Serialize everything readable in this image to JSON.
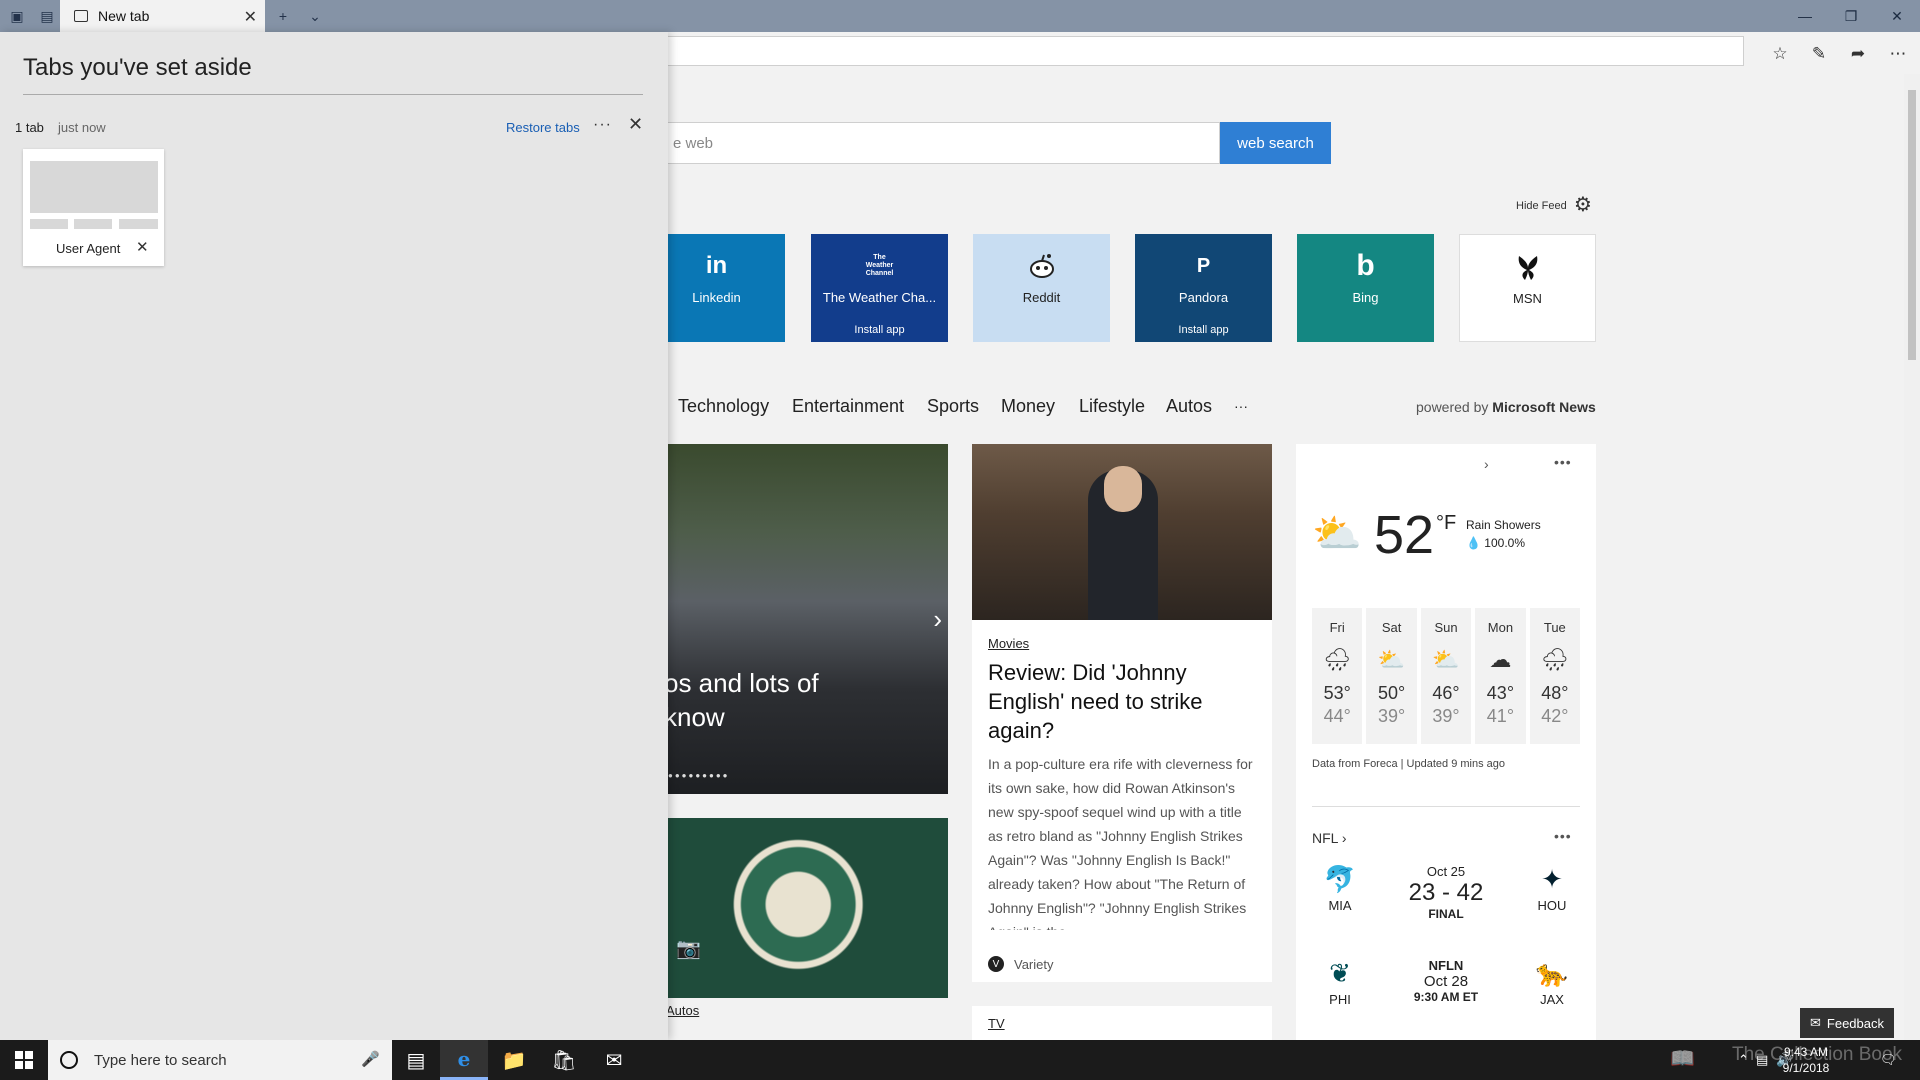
{
  "tab": {
    "title": "New tab"
  },
  "ntp": {
    "search_placeholder": "e web",
    "search_button": "web search",
    "hide_feed": "Hide Feed",
    "tiles": [
      {
        "label": "Linkedin",
        "icon": "in",
        "install": "",
        "color": "#0a77b5"
      },
      {
        "label": "The Weather Cha...",
        "icon": "The Weather Channel",
        "install": "Install app",
        "color": "#123d8c"
      },
      {
        "label": "Reddit",
        "icon": "reddit-alien",
        "install": "",
        "color": "#c8ddf2"
      },
      {
        "label": "Pandora",
        "icon": "P",
        "install": "Install app",
        "color": "#114775"
      },
      {
        "label": "Bing",
        "icon": "b",
        "install": "",
        "color": "#148782"
      },
      {
        "label": "MSN",
        "icon": "butterfly",
        "install": "",
        "color": "#ffffff"
      }
    ],
    "nav": [
      "Technology",
      "Entertainment",
      "Sports",
      "Money",
      "Lifestyle",
      "Autos",
      "···"
    ],
    "powered_by_prefix": "powered by",
    "powered_by_brand": "Microsoft News",
    "hero": {
      "headline_line1": "os and lots of",
      "headline_line2": "know",
      "dots": "●●●●●●●●●"
    },
    "autos_tag": "Autos",
    "movie": {
      "tag": "Movies",
      "title": "Review: Did 'Johnny English' need to strike again?",
      "body": "In a pop-culture era rife with cleverness for its own sake, how did Rowan Atkinson's new spy-spoof sequel wind up with a title as retro bland as \"Johnny English Strikes Again\"? Was \"Johnny English Is Back!\" already taken? How about \"The Return of Johnny English\"? \"Johnny English Strikes Again\" is the",
      "source": "Variety"
    },
    "tv_tag": "TV",
    "weather": {
      "temp": "52",
      "unit": "°F",
      "condition": "Rain Showers",
      "precip": "100.0%",
      "days": [
        {
          "name": "Fri",
          "hi": "53°",
          "lo": "44°",
          "icon": "rain-icon"
        },
        {
          "name": "Sat",
          "hi": "50°",
          "lo": "39°",
          "icon": "partly-sunny-icon"
        },
        {
          "name": "Sun",
          "hi": "46°",
          "lo": "39°",
          "icon": "partly-sunny-icon"
        },
        {
          "name": "Mon",
          "hi": "43°",
          "lo": "41°",
          "icon": "cloud-icon"
        },
        {
          "name": "Tue",
          "hi": "48°",
          "lo": "42°",
          "icon": "rain-icon"
        }
      ],
      "data_source": "Data from Foreca | Updated 9 mins ago"
    },
    "nfl": {
      "label": "NFL",
      "games": [
        {
          "away": "MIA",
          "home": "HOU",
          "line1": "Oct 25",
          "line2": "23 - 42",
          "line3": "FINAL"
        },
        {
          "away": "PHI",
          "home": "JAX",
          "line1": "NFLN",
          "line2": "Oct 28",
          "line3": "9:30 AM ET"
        }
      ]
    },
    "feedback": "Feedback"
  },
  "aside": {
    "title": "Tabs you've set aside",
    "count": "1 tab",
    "time": "just now",
    "restore": "Restore tabs",
    "more": "···",
    "saved_tab": "User Agent"
  },
  "taskbar": {
    "search_placeholder": "Type here to search",
    "time": "9:43 AM",
    "date": "9/1/2018"
  },
  "watermark": "The Collection Book"
}
